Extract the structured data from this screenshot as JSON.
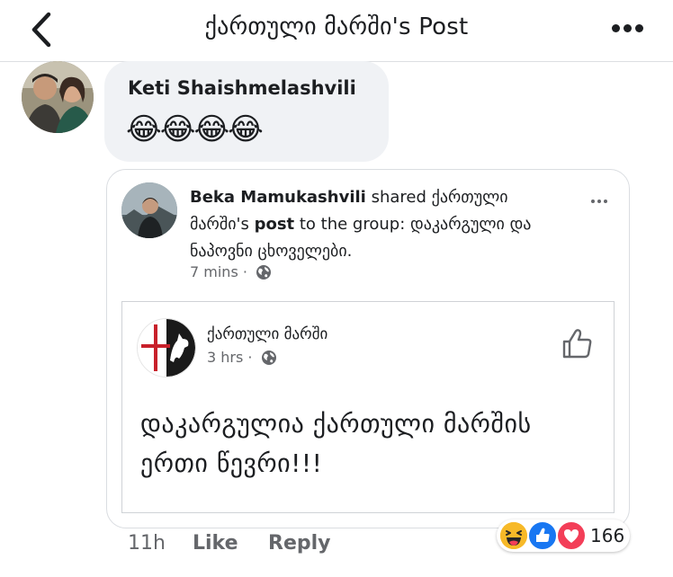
{
  "header": {
    "title": "ქართული მარში's Post",
    "back_icon": "chevron-left-icon",
    "more_icon": "more-horizontal-icon"
  },
  "comment": {
    "author": "Keti Shaishmelashvili",
    "text": "😂😂😂😂",
    "time": "11h",
    "like_label": "Like",
    "reply_label": "Reply",
    "reactions": {
      "types": [
        "haha",
        "like",
        "love"
      ],
      "count": "166"
    }
  },
  "shared_post": {
    "sharer": "Beka Mamukashvili",
    "action_text": " shared ",
    "page_name": "ქართული მარში's",
    "post_word": "post",
    "group_prefix": " to the group: ",
    "group_name": "დაკარგული და ნაპოვნი ცხოველები.",
    "time": "7 mins",
    "separator": "·",
    "privacy_icon": "globe-icon"
  },
  "inner_post": {
    "page_name": "ქართული მარში",
    "time": "3 hrs",
    "separator": "·",
    "text": "დაკარგულია ქართული მარშის ერთი წევრი!!!"
  },
  "colors": {
    "bubble_bg": "#f0f2f5",
    "meta_text": "#65676b",
    "like_blue": "#1877f2",
    "love_red": "#f33e58",
    "haha_yellow": "#f7b928"
  }
}
